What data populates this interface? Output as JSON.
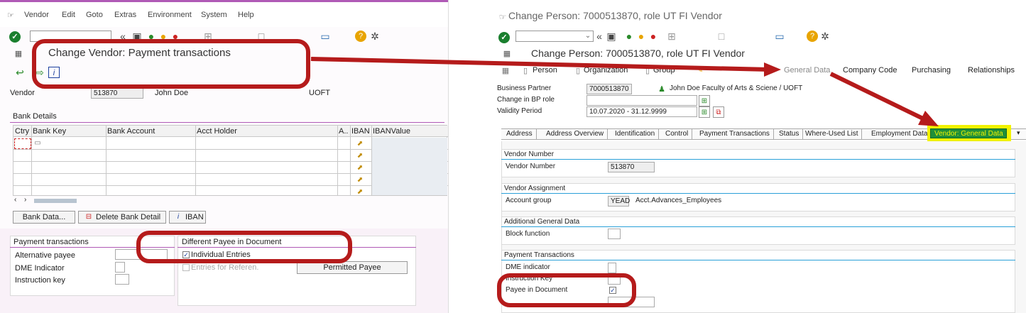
{
  "left": {
    "menu": [
      "Vendor",
      "Edit",
      "Goto",
      "Extras",
      "Environment",
      "System",
      "Help"
    ],
    "title": "Change Vendor: Payment transactions",
    "vendor_label": "Vendor",
    "vendor_number": "513870",
    "vendor_name": "John Doe",
    "vendor_city": "UOFT",
    "bank_details_title": "Bank Details",
    "bank_columns": [
      "Ctry",
      "Bank Key",
      "Bank Account",
      "Acct Holder",
      "A..",
      "IBAN",
      "IBANValue"
    ],
    "buttons": {
      "bank_data": "Bank Data...",
      "delete_bank_detail": "Delete Bank Detail",
      "iban": "IBAN"
    },
    "payment_transactions": {
      "title": "Payment transactions",
      "fields": [
        "Alternative payee",
        "DME Indicator",
        "Instruction key"
      ]
    },
    "different_payee": {
      "title": "Different Payee in Document",
      "individual_entries": "Individual Entries",
      "entries_for_referen": "Entries for Referen.",
      "permitted_payee_button": "Permitted Payee"
    }
  },
  "right": {
    "window_title": "Change Person: 7000513870, role UT FI Vendor",
    "title": "Change Person: 7000513870, role UT FI Vendor",
    "toolbar_items": [
      "Person",
      "Organization",
      "Group",
      "General Data",
      "Company Code",
      "Purchasing",
      "Relationships"
    ],
    "header_fields": {
      "business_partner_label": "Business Partner",
      "business_partner_value": "7000513870",
      "business_partner_desc": "John Doe Faculty of Arts & Sciene / UOFT",
      "change_in_bp_role_label": "Change in BP role",
      "validity_period_label": "Validity Period",
      "validity_period_value": "10.07.2020 - 31.12.9999"
    },
    "tabs": [
      "Address",
      "Address Overview",
      "Identification",
      "Control",
      "Payment Transactions",
      "Status",
      "Where-Used List",
      "Employment Data",
      "Vendor: General Data"
    ],
    "active_tab": "Vendor: General Data",
    "sections": {
      "vendor_number_title": "Vendor Number",
      "vendor_number_label": "Vendor Number",
      "vendor_number_value": "513870",
      "vendor_assignment_title": "Vendor Assignment",
      "account_group_label": "Account group",
      "account_group_code": "YEAD",
      "account_group_desc": "Acct.Advances_Employees",
      "additional_title": "Additional General Data",
      "block_function_label": "Block function",
      "payment_title": "Payment Transactions",
      "dme_label": "DME indicator",
      "instruction_key_label": "Instruction Key",
      "payee_in_doc_label": "Payee in Document"
    }
  },
  "colors": {
    "highlight_red": "#b51b1b",
    "sap_purple": "#b05ab6",
    "tab_active_green": "#1f8f3a",
    "tab_highlight_yellow": "#f2f200"
  }
}
